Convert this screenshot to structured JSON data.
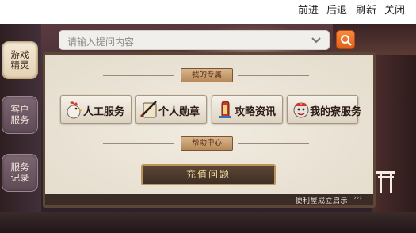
{
  "browser_nav": {
    "forward": "前进",
    "back": "后退",
    "refresh": "刷新",
    "close": "关闭"
  },
  "side_tabs": [
    {
      "label": "游戏精灵",
      "active": true
    },
    {
      "label": "客户服务",
      "active": false
    },
    {
      "label": "服务记录",
      "active": false
    }
  ],
  "search": {
    "placeholder": "请输入提问内容"
  },
  "sections": {
    "mine_title": "我的专属",
    "help_title": "帮助中心"
  },
  "services": [
    {
      "label": "人工服务",
      "icon": "rooster-icon"
    },
    {
      "label": "个人勋章",
      "icon": "scroll-brush-icon"
    },
    {
      "label": "攻略资讯",
      "icon": "lantern-scroll-icon"
    },
    {
      "label": "我的寮服务",
      "icon": "lion-dance-icon"
    }
  ],
  "recharge_label": "充值问题",
  "footer_text": "便利屋成立启示",
  "footer_arrows": "›››",
  "colors": {
    "accent": "#e86a24",
    "panel": "#e9e2d4",
    "frame": "#5c4636"
  }
}
